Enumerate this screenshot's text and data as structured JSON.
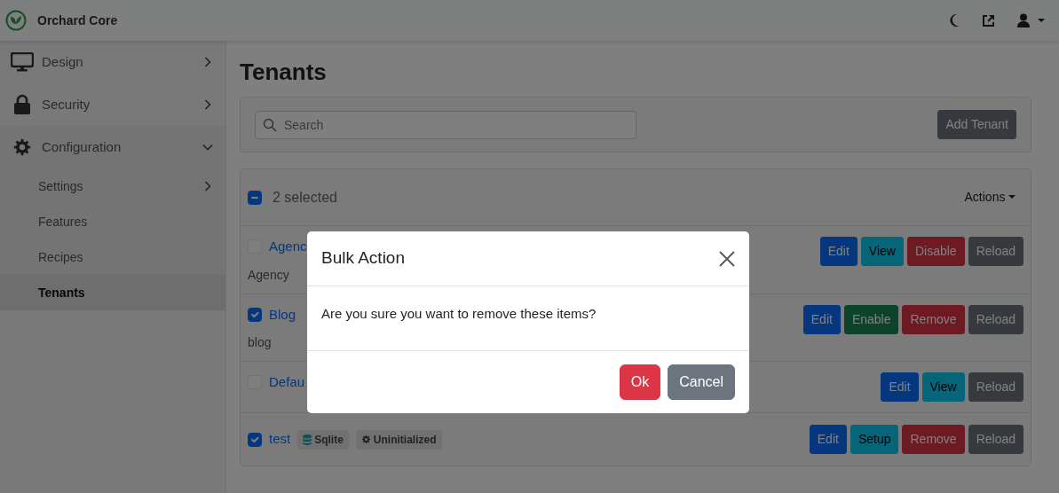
{
  "navbar": {
    "brand": "Orchard Core"
  },
  "sidebar": {
    "items": [
      {
        "label": "Design",
        "expanded": false,
        "selected": false
      },
      {
        "label": "Security",
        "expanded": false,
        "selected": false
      },
      {
        "label": "Configuration",
        "expanded": true,
        "selected": false,
        "children": [
          {
            "label": "Settings",
            "expanded": false,
            "selected": false
          },
          {
            "label": "Features",
            "selected": false
          },
          {
            "label": "Recipes",
            "selected": false
          },
          {
            "label": "Tenants",
            "selected": true
          }
        ]
      }
    ]
  },
  "page": {
    "title": "Tenants"
  },
  "search": {
    "placeholder": "Search"
  },
  "add_button": "Add Tenant",
  "list_header": {
    "indeterminate": true,
    "selected_count": "2 selected",
    "actions": "Actions"
  },
  "rows": [
    {
      "name": "Agenc",
      "checked": false,
      "description": "Agency",
      "buttons": [
        {
          "label": "Edit",
          "kind": "primary"
        },
        {
          "label": "View",
          "kind": "info"
        },
        {
          "label": "Disable",
          "kind": "danger"
        },
        {
          "label": "Reload",
          "kind": "secondary"
        }
      ]
    },
    {
      "name": "Blog",
      "checked": true,
      "description": "blog",
      "buttons": [
        {
          "label": "Edit",
          "kind": "primary"
        },
        {
          "label": "Enable",
          "kind": "success"
        },
        {
          "label": "Remove",
          "kind": "danger"
        },
        {
          "label": "Reload",
          "kind": "secondary"
        }
      ]
    },
    {
      "name": "Defau",
      "checked": false,
      "buttons": [
        {
          "label": "Edit",
          "kind": "primary"
        },
        {
          "label": "View",
          "kind": "info"
        },
        {
          "label": "Reload",
          "kind": "secondary"
        }
      ]
    },
    {
      "name": "test",
      "checked": true,
      "badges": [
        {
          "label": "Sqlite",
          "kind": "database"
        },
        {
          "label": "Uninitialized",
          "kind": "gear"
        }
      ],
      "buttons": [
        {
          "label": "Edit",
          "kind": "primary"
        },
        {
          "label": "Setup",
          "kind": "info"
        },
        {
          "label": "Remove",
          "kind": "danger"
        },
        {
          "label": "Reload",
          "kind": "secondary"
        }
      ]
    }
  ],
  "modal": {
    "title": "Bulk Action",
    "message": "Are you sure you want to remove these items?",
    "buttons": [
      {
        "label": "Ok",
        "kind": "danger"
      },
      {
        "label": "Cancel",
        "kind": "secondary"
      }
    ]
  }
}
